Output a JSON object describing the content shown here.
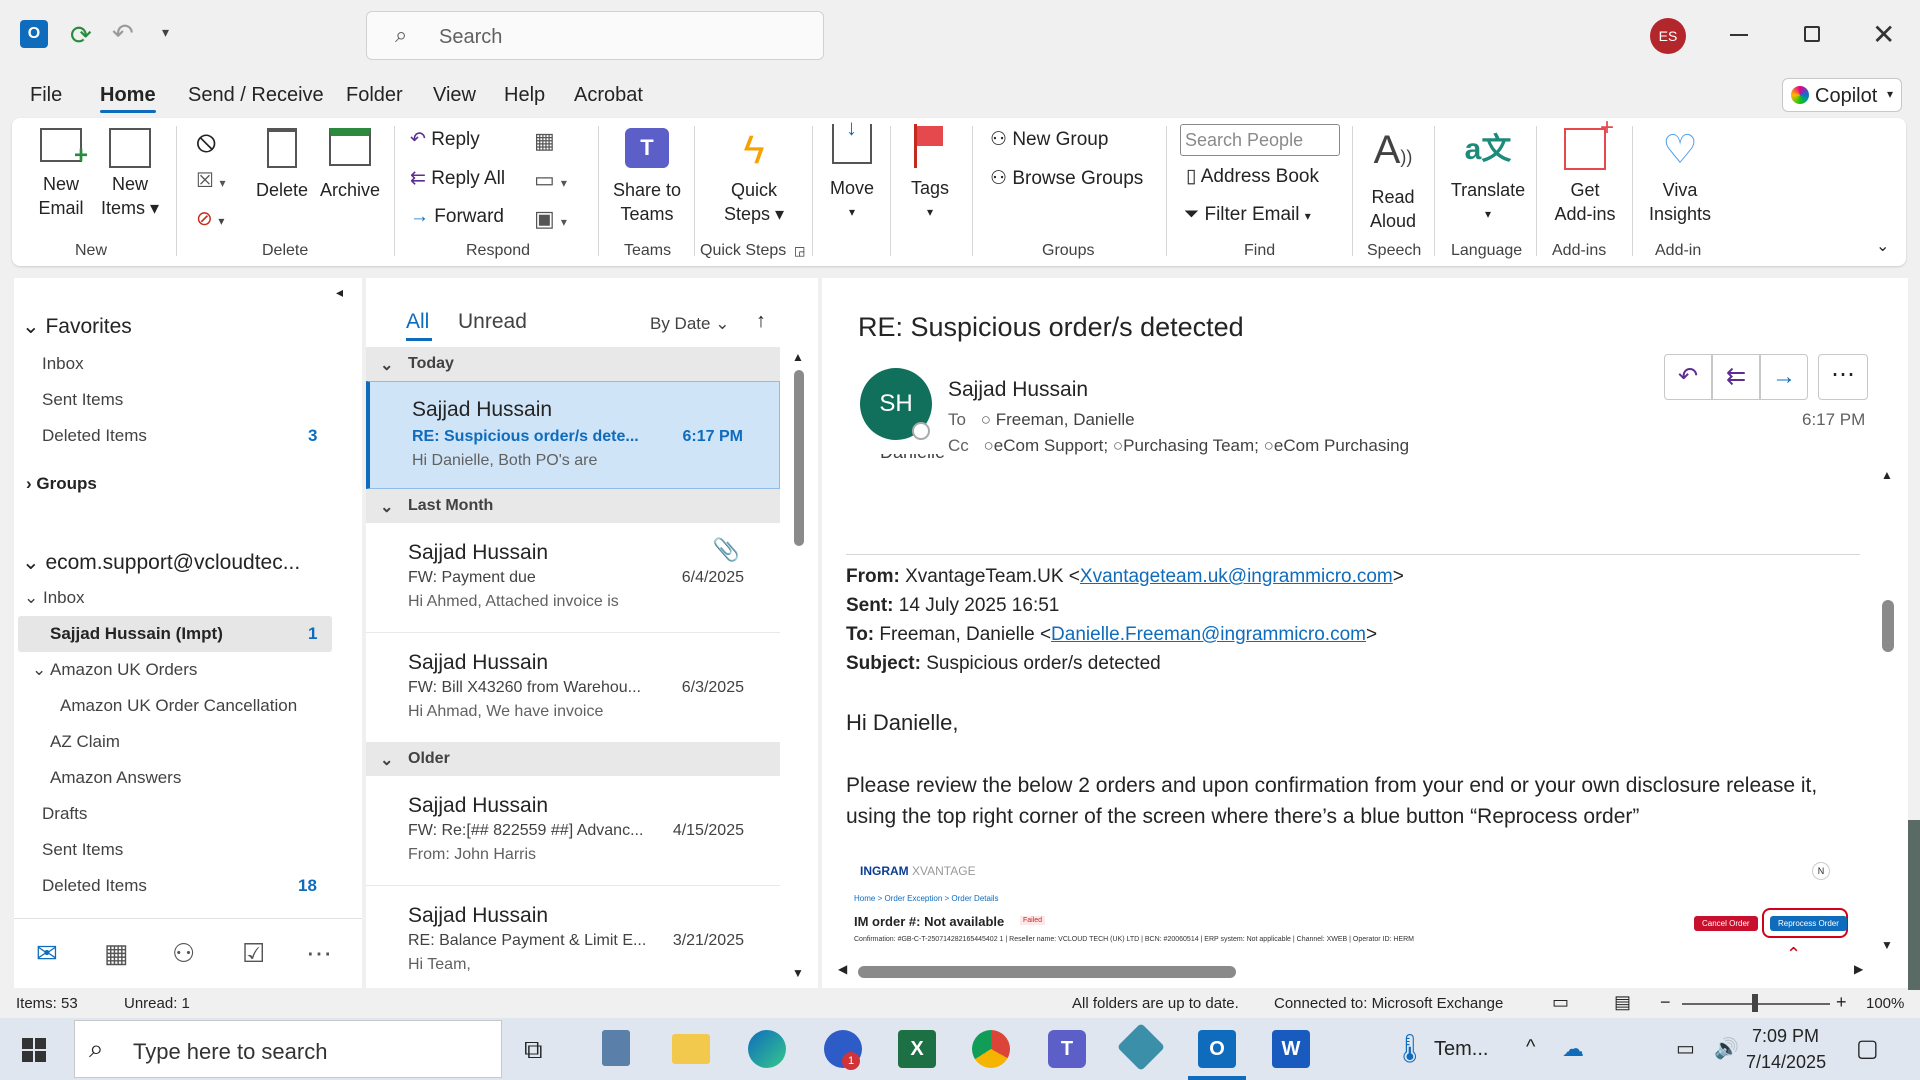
{
  "titlebar": {
    "search_placeholder": "Search",
    "avatar_initials": "ES"
  },
  "menu": {
    "items": [
      "File",
      "Home",
      "Send / Receive",
      "Folder",
      "View",
      "Help",
      "Acrobat"
    ],
    "active": "Home",
    "copilot_label": "Copilot"
  },
  "ribbon": {
    "new_email": "New\nEmail",
    "new_email_l1": "New",
    "new_email_l2": "Email",
    "new_items_l1": "New",
    "new_items_l2": "Items",
    "delete": "Delete",
    "archive": "Archive",
    "reply": "Reply",
    "reply_all": "Reply All",
    "forward": "Forward",
    "share_l1": "Share to",
    "share_l2": "Teams",
    "quick_l1": "Quick",
    "quick_l2": "Steps",
    "move": "Move",
    "tags": "Tags",
    "new_group": "New Group",
    "browse_groups": "Browse Groups",
    "search_people_placeholder": "Search People",
    "address_book": "Address Book",
    "filter_email": "Filter Email",
    "read_l1": "Read",
    "read_l2": "Aloud",
    "translate": "Translate",
    "addins_l1": "Get",
    "addins_l2": "Add-ins",
    "viva_l1": "Viva",
    "viva_l2": "Insights",
    "groups": {
      "new": "New",
      "delete": "Delete",
      "respond": "Respond",
      "teams": "Teams",
      "quick_steps": "Quick Steps",
      "groups": "Groups",
      "find": "Find",
      "speech": "Speech",
      "language": "Language",
      "addins": "Add-ins",
      "addin": "Add-in"
    }
  },
  "nav": {
    "favorites": "Favorites",
    "fav_inbox": "Inbox",
    "fav_sent": "Sent Items",
    "fav_deleted": "Deleted Items",
    "fav_deleted_count": "3",
    "groups": "Groups",
    "account": "ecom.support@vcloudtec...",
    "inbox": "Inbox",
    "sajjad": "Sajjad Hussain (Impt)",
    "sajjad_count": "1",
    "amazon_uk_orders": "Amazon UK Orders",
    "amazon_cancel": "Amazon UK Order Cancellation",
    "az_claim": "AZ Claim",
    "amazon_answers": "Amazon Answers",
    "drafts": "Drafts",
    "sent": "Sent Items",
    "deleted": "Deleted Items",
    "deleted_count": "18"
  },
  "list": {
    "tab_all": "All",
    "tab_unread": "Unread",
    "sort": "By Date",
    "group_today": "Today",
    "group_last_month": "Last Month",
    "group_older": "Older",
    "messages": [
      {
        "sender": "Sajjad Hussain",
        "subject": "RE: Suspicious order/s dete...",
        "preview": "Hi Danielle,   Both PO's are",
        "date": "6:17 PM"
      },
      {
        "sender": "Sajjad Hussain",
        "subject": "FW: Payment due",
        "preview": "Hi Ahmed,   Attached invoice is",
        "date": "6/4/2025"
      },
      {
        "sender": "Sajjad Hussain",
        "subject": "FW: Bill X43260 from Warehou...",
        "preview": "Hi Ahmad,   We have invoice",
        "date": "6/3/2025"
      },
      {
        "sender": "Sajjad Hussain",
        "subject": "FW: Re:[## 822559 ##] Advanc...",
        "preview": "From: John Harris",
        "date": "4/15/2025"
      },
      {
        "sender": "Sajjad Hussain",
        "subject": "RE: Balance Payment & Limit E...",
        "preview": "Hi Team,",
        "date": "3/21/2025"
      }
    ]
  },
  "reading": {
    "subject": "RE: Suspicious order/s detected",
    "sender_initials": "SH",
    "sender": "Sajjad Hussain",
    "to_label": "To",
    "to": "Freeman, Danielle",
    "cc_label": "Cc",
    "cc1": "eCom Support;",
    "cc2": "Purchasing Team;",
    "cc3": "eCom Purchasing",
    "time": "6:17 PM",
    "clipped_top": "Danielle",
    "from_label": "From:",
    "from_name": "XvantageTeam.UK <",
    "from_email": "Xvantageteam.uk@ingrammicro.com",
    "from_end": ">",
    "sent_label": "Sent:",
    "sent_value": "14 July 2025 16:51",
    "to2_label": "To:",
    "to2_name": "Freeman, Danielle <",
    "to2_email": "Danielle.Freeman@ingrammicro.com",
    "to2_end": ">",
    "subject_label": "Subject:",
    "subject_value": "Suspicious order/s detected",
    "greeting": "Hi Danielle,",
    "body": "Please review the below 2 orders and upon confirmation from your end or your own disclosure release it, using the top right corner of the screen where there’s a blue button “Reprocess order”",
    "embed": {
      "brand": "XVANTAGE",
      "crumb": "Home  >  Order Exception  >  Order Details",
      "order_title": "IM order #: Not available",
      "failed": "Failed",
      "details": "Confirmation: #GB-C-T-250714282165445402 1  |  Reseller name: VCLOUD TECH (UK) LTD  |  BCN: #20060514  |  ERP system: Not applicable  |  Channel: XWEB  |  Operator ID: HERM",
      "cancel": "Cancel Order",
      "reprocess": "Reprocess Order"
    }
  },
  "status": {
    "items": "Items: 53",
    "unread": "Unread: 1",
    "sync": "All folders are up to date.",
    "connected": "Connected to: Microsoft Exchange",
    "zoom": "100%"
  },
  "taskbar": {
    "search_placeholder": "Type here to search",
    "weather": "Tem...",
    "time": "7:09 PM",
    "date": "7/14/2025",
    "teams_badge": "1"
  }
}
